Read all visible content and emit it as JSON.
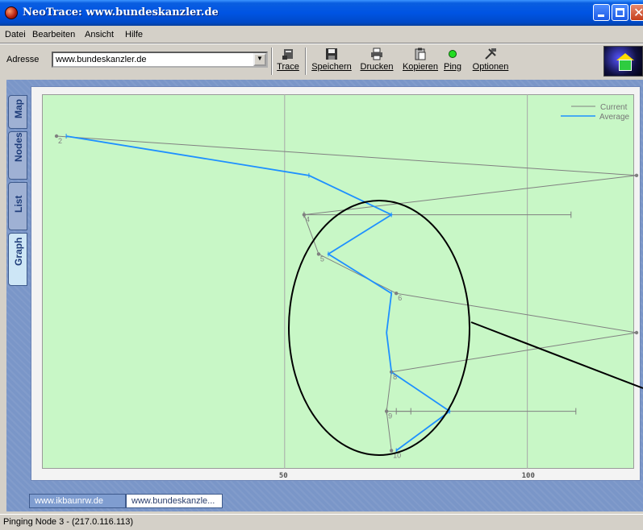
{
  "window": {
    "title": "NeoTrace: www.bundeskanzler.de"
  },
  "menu": [
    "Datei",
    "Bearbeiten",
    "Ansicht",
    "Hilfe"
  ],
  "address": {
    "label": "Adresse",
    "value": "www.bundeskanzler.de"
  },
  "toolbar": {
    "trace": "Trace",
    "save": "Speichern",
    "print": "Drucken",
    "copy": "Kopieren",
    "ping": "Ping",
    "options": "Optionen"
  },
  "side_tabs": [
    "Map",
    "Nodes",
    "List",
    "Graph"
  ],
  "active_side_tab": "Graph",
  "legend": {
    "current": "Current",
    "average": "Average"
  },
  "bottom_tabs": [
    "www.ikbaunrw.de",
    "www.bundeskanzle..."
  ],
  "status": "Pinging Node 3 -  (217.0.116.113)",
  "colors": {
    "current": "#808080",
    "average": "#1e90ff",
    "plot_bg": "#c8f7c6"
  },
  "chart_data": {
    "type": "line",
    "x_ticks": [
      50,
      100
    ],
    "xlim": [
      0,
      122
    ],
    "node_labels": [
      "2",
      "4",
      "5",
      "6",
      "8",
      "9",
      "10"
    ],
    "series": [
      {
        "name": "Current",
        "points": [
          [
            3,
            1
          ],
          [
            123,
            2
          ],
          [
            54,
            3
          ],
          [
            57,
            4
          ],
          [
            73,
            5
          ],
          [
            123,
            6
          ],
          [
            72,
            7
          ],
          [
            71,
            8
          ],
          [
            72,
            9
          ]
        ]
      },
      {
        "name": "Average",
        "points": [
          [
            5,
            1
          ],
          [
            55,
            2
          ],
          [
            72,
            3
          ],
          [
            59,
            4
          ],
          [
            72,
            5
          ],
          [
            71,
            6
          ],
          [
            72,
            7
          ],
          [
            84,
            8
          ],
          [
            73,
            9
          ]
        ]
      }
    ],
    "ranges": [
      [
        54,
        109,
        3
      ],
      [
        73,
        8
      ],
      [
        71,
        110,
        8
      ]
    ]
  }
}
